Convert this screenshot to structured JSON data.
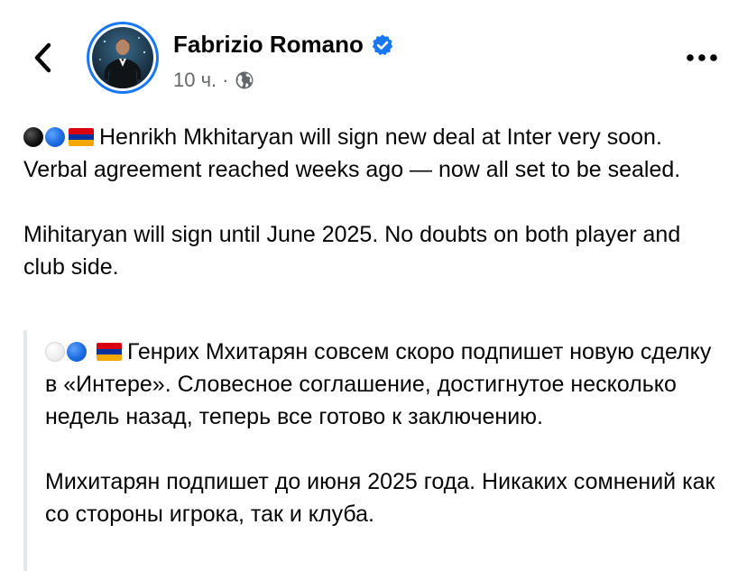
{
  "header": {
    "author": "Fabrizio Romano",
    "time": "10 ч.",
    "separator": "·",
    "icons": {
      "back": "chevron-left-icon",
      "verified": "verified-badge-icon",
      "audience": "globe-icon",
      "more": "more-dots-icon"
    },
    "verified_color": "#1877f2"
  },
  "post": {
    "paragraph1": "Henrikh Mkhitaryan will sign new deal at Inter very soon. Verbal agreement reached weeks ago — now all set to be sealed.",
    "paragraph2": "Mihitaryan will sign until June 2025. No doubts on both player and club side."
  },
  "translation": {
    "paragraph1": "Генрих Мхитарян совсем скоро подпишет новую сделку в «Интере». Словесное соглашение, достигнутое несколько недель назад, теперь все готово к заключению.",
    "paragraph2": "Михитарян подпишет до июня 2025 года. Никаких сомнений как со стороны игрока, так и клуба."
  },
  "colors": {
    "text": "#050505",
    "meta": "#65676b",
    "accent": "#1877f2",
    "quote_border": "#e4e6eb"
  }
}
